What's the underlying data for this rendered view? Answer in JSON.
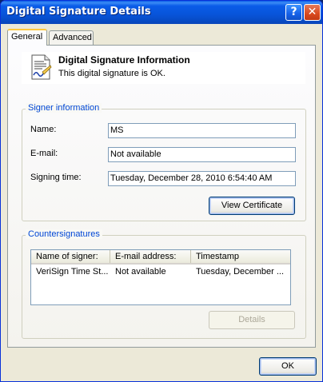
{
  "window": {
    "title": "Digital Signature Details",
    "help_glyph": "?",
    "close_glyph": "✕"
  },
  "tabs": [
    {
      "label": "General",
      "active": true
    },
    {
      "label": "Advanced",
      "active": false
    }
  ],
  "info": {
    "icon": "signed-document-icon",
    "title": "Digital Signature Information",
    "status": "This digital signature is OK."
  },
  "signer": {
    "group_label": "Signer information",
    "name_label": "Name:",
    "name_value": "MS",
    "email_label": "E-mail:",
    "email_value": "Not available",
    "time_label": "Signing time:",
    "time_value": "Tuesday, December 28, 2010 6:54:40 AM",
    "view_certificate_label": "View Certificate"
  },
  "countersignatures": {
    "group_label": "Countersignatures",
    "columns": [
      "Name of signer:",
      "E-mail address:",
      "Timestamp"
    ],
    "rows": [
      [
        "VeriSign Time St...",
        "Not available",
        "Tuesday, December ..."
      ]
    ],
    "details_label": "Details"
  },
  "footer": {
    "ok_label": "OK"
  },
  "colors": {
    "titlebar": "#0a5ce8",
    "group_label": "#0046d5",
    "tab_highlight": "#ffc83c"
  }
}
